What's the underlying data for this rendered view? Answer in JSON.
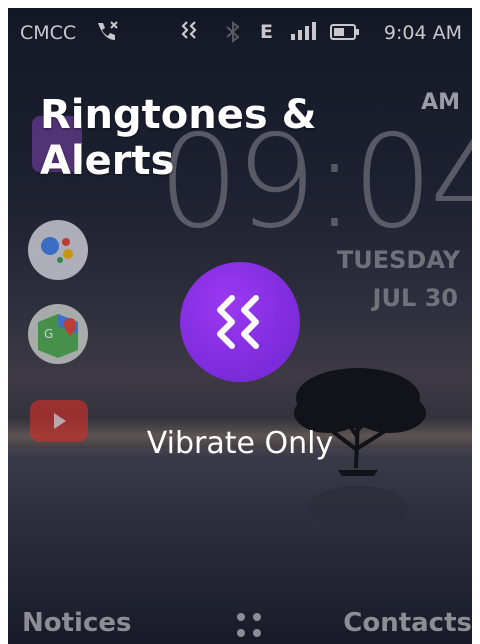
{
  "status_bar": {
    "carrier": "CMCC",
    "network": "E",
    "time": "9:04 AM",
    "icons": [
      "call-icon",
      "vibrate-icon",
      "bluetooth-icon",
      "signal-icon",
      "battery-icon"
    ]
  },
  "clock": {
    "ampm": "AM",
    "time": "09:04",
    "day": "TUESDAY",
    "date": "JUL 30"
  },
  "overlay": {
    "title_line1": "Ringtones &",
    "title_line2": "Alerts",
    "mode_label": "Vibrate Only",
    "accent_color": "#8a30e8"
  },
  "softkeys": {
    "left": "Notices",
    "right": "Contacts"
  },
  "apps": [
    "app-icon",
    "assistant-icon",
    "maps-icon",
    "youtube-icon"
  ]
}
